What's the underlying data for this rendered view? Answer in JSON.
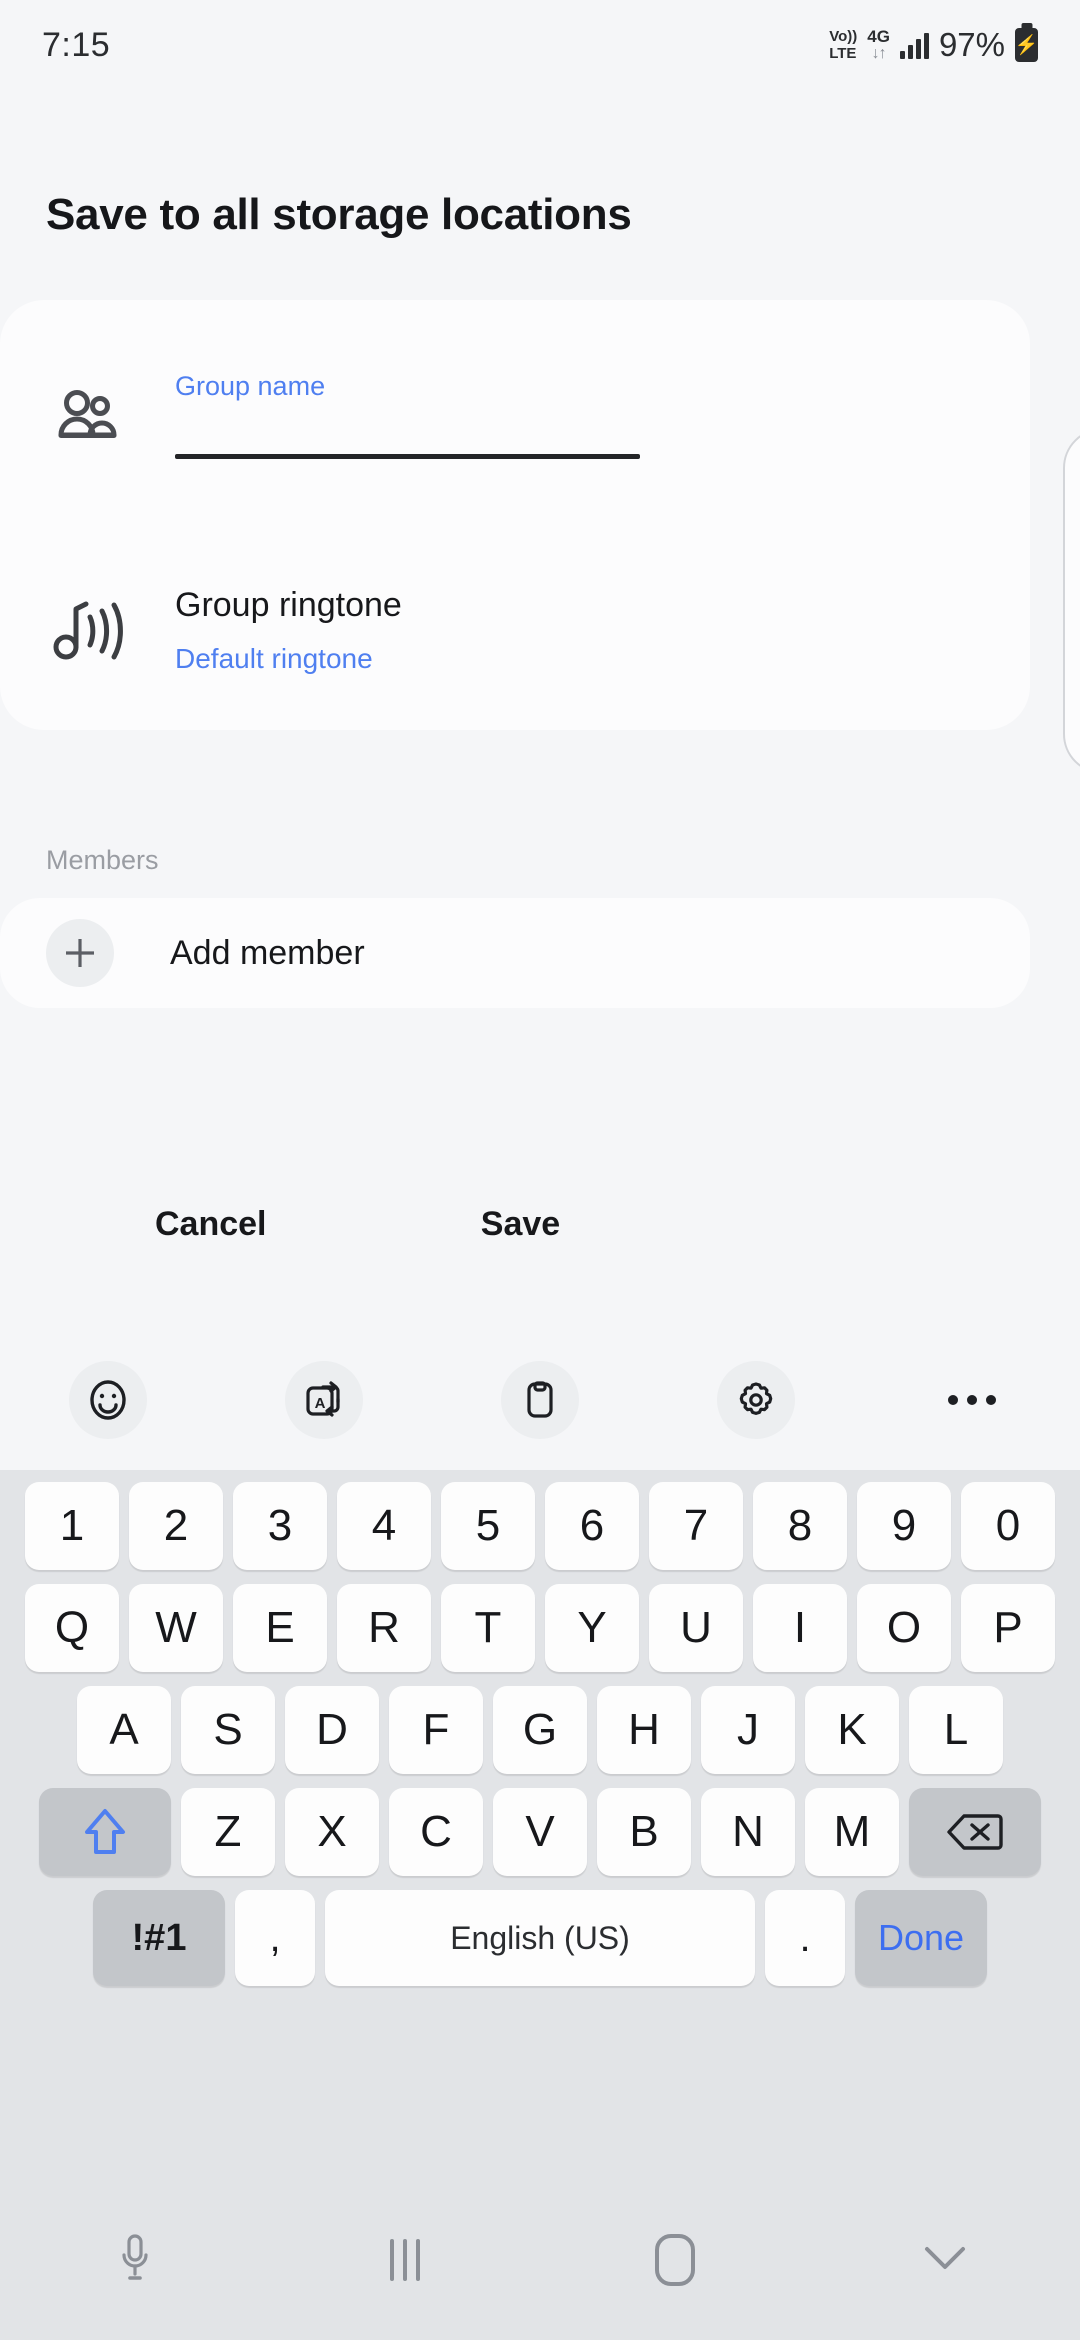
{
  "status_bar": {
    "time": "7:15",
    "volte_top": "Vo))",
    "volte_bottom": "LTE",
    "network": "4G",
    "data_arrows": "↓↑",
    "battery_percent": "97%",
    "charging_glyph": "⚡"
  },
  "page": {
    "title": "Save to all storage locations"
  },
  "form": {
    "group_name": {
      "label": "Group name",
      "value": "",
      "icon": "people-icon"
    },
    "group_ringtone": {
      "title": "Group ringtone",
      "subtitle": "Default ringtone",
      "icon": "ringtone-icon"
    }
  },
  "members": {
    "section_label": "Members",
    "add_member_label": "Add member",
    "add_icon": "plus-icon"
  },
  "actions": {
    "cancel_label": "Cancel",
    "save_label": "Save"
  },
  "keyboard_toolbar": {
    "items": [
      {
        "name": "emoji-icon",
        "label": "emoji"
      },
      {
        "name": "translate-icon",
        "label": "translate"
      },
      {
        "name": "clipboard-icon",
        "label": "clipboard"
      },
      {
        "name": "gear-icon",
        "label": "settings"
      },
      {
        "name": "more-icon",
        "label": "more"
      }
    ]
  },
  "keyboard": {
    "number_row": [
      "1",
      "2",
      "3",
      "4",
      "5",
      "6",
      "7",
      "8",
      "9",
      "0"
    ],
    "letter_row_1": [
      "Q",
      "W",
      "E",
      "R",
      "T",
      "Y",
      "U",
      "I",
      "O",
      "P"
    ],
    "letter_row_2": [
      "A",
      "S",
      "D",
      "F",
      "G",
      "H",
      "J",
      "K",
      "L"
    ],
    "letter_row_3": [
      "Z",
      "X",
      "C",
      "V",
      "B",
      "N",
      "M"
    ],
    "shift_key": "shift-key",
    "backspace_key": "backspace-key",
    "symbols_key": "!#1",
    "comma_key": ",",
    "space_key": "English (US)",
    "period_key": ".",
    "done_key": "Done"
  },
  "nav_bar": {
    "items": [
      {
        "name": "microphone-icon"
      },
      {
        "name": "recents-icon"
      },
      {
        "name": "home-icon"
      },
      {
        "name": "hide-keyboard-icon"
      }
    ]
  },
  "colors": {
    "accent_blue": "#4f7ff0",
    "done_blue": "#3d6ef0",
    "background": "#f5f6f8",
    "card": "#fcfcfd",
    "keyboard_bg": "#e2e4e7",
    "key_white": "#fdfdfd",
    "key_mod": "#c3c6ca",
    "text_primary": "#17181b",
    "text_muted": "#9a9da3"
  }
}
